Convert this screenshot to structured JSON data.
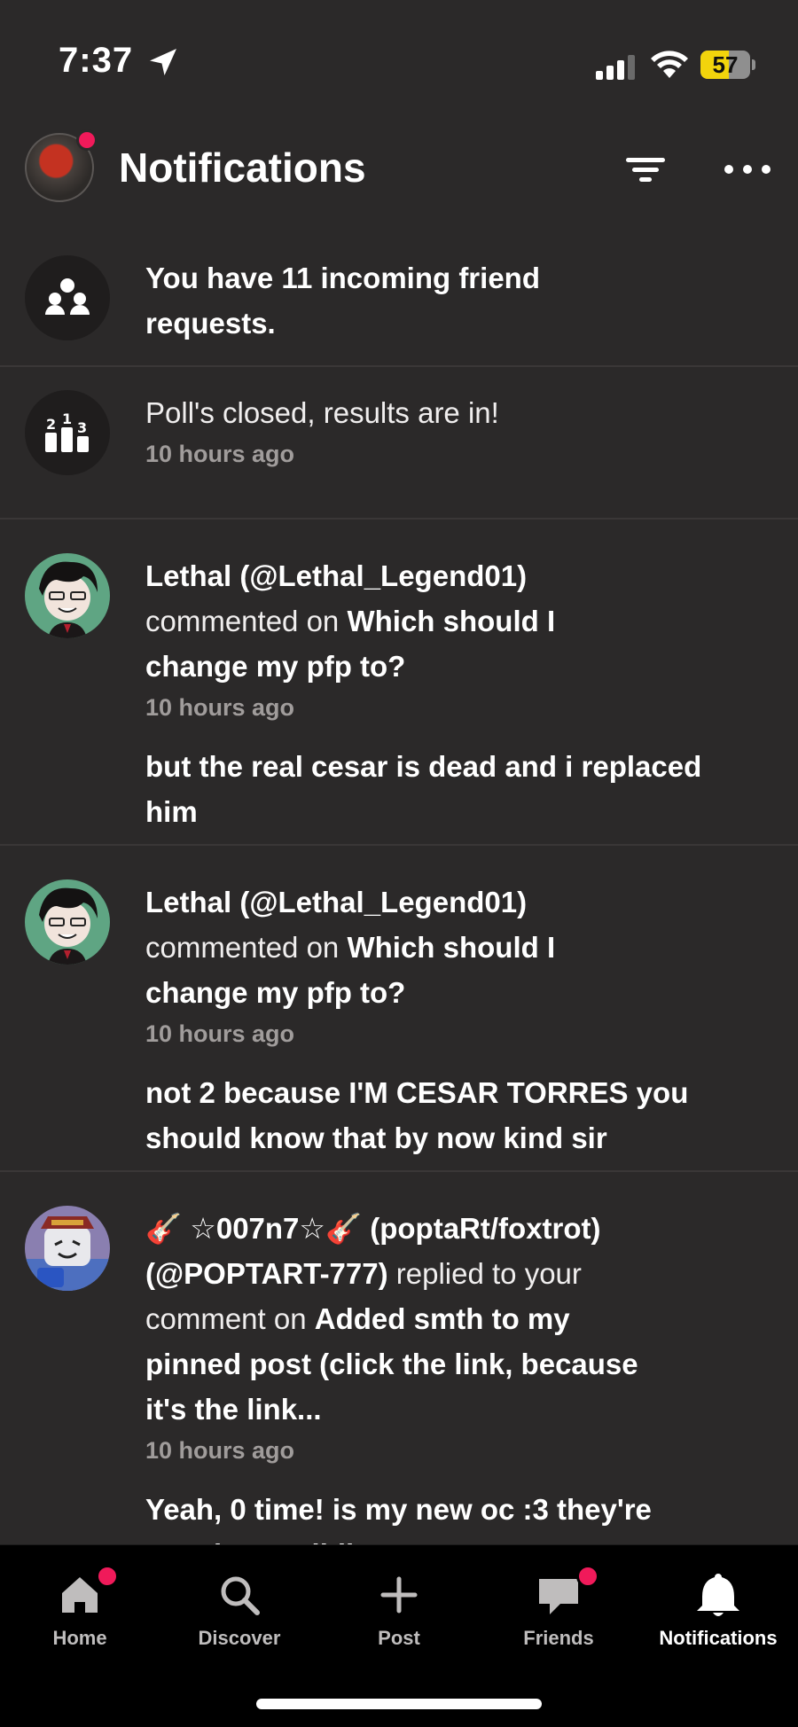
{
  "status_bar": {
    "time": "7:37",
    "battery": "57",
    "battery_level": 0.57,
    "battery_color": "#f2d40c"
  },
  "header": {
    "title": "Notifications"
  },
  "notifications": [
    {
      "type": "friend_requests",
      "text": "You have 11 incoming friend requests.",
      "text_line1": "You have 11 incoming friend",
      "text_line2": "requests."
    },
    {
      "type": "poll",
      "text": "Poll's closed, results are in!",
      "time": "10 hours ago"
    },
    {
      "type": "comment",
      "user": "Lethal (@Lethal_Legend01)",
      "action": "commented on",
      "post_line1": "Which should I",
      "post_line2": "change my pfp to?",
      "time": "10 hours ago",
      "comment_line1": "but the real cesar is dead and i replaced",
      "comment_line2": "him"
    },
    {
      "type": "comment",
      "user": "Lethal (@Lethal_Legend01)",
      "action": "commented on",
      "post_line1": "Which should I",
      "post_line2": "change my pfp to?",
      "time": "10 hours ago",
      "comment_line1": "not 2 because I'M CESAR TORRES you",
      "comment_line2": "should know that by now kind sir"
    },
    {
      "type": "reply",
      "user_name": "🎸 ☆007n7☆🎸  (poptaRt/foxtrot)",
      "user_handle": "(@POPTART-777)",
      "action_1": "replied to your",
      "action_2": "comment on",
      "post_line1": "Added smth to my",
      "post_line2": "pinned post (click the link, because",
      "post_line3": "it's the link...",
      "time": "10 hours ago",
      "comment_line1": "Yeah, 0 time! is my new oc :3  they're",
      "comment_line2": "two time's sibling"
    }
  ],
  "tabbar": {
    "tabs": [
      {
        "label": "Home",
        "icon": "home-icon",
        "badge": true
      },
      {
        "label": "Discover",
        "icon": "search-icon",
        "badge": false
      },
      {
        "label": "Post",
        "icon": "plus-icon",
        "badge": false
      },
      {
        "label": "Friends",
        "icon": "chat-bubble-icon",
        "badge": true
      },
      {
        "label": "Notifications",
        "icon": "bell-icon",
        "badge": false,
        "active": true
      }
    ]
  },
  "colors": {
    "background": "#2b2929",
    "badge": "#f01a5a",
    "tabbar": "#000000",
    "muted_text": "#a09c9b"
  }
}
